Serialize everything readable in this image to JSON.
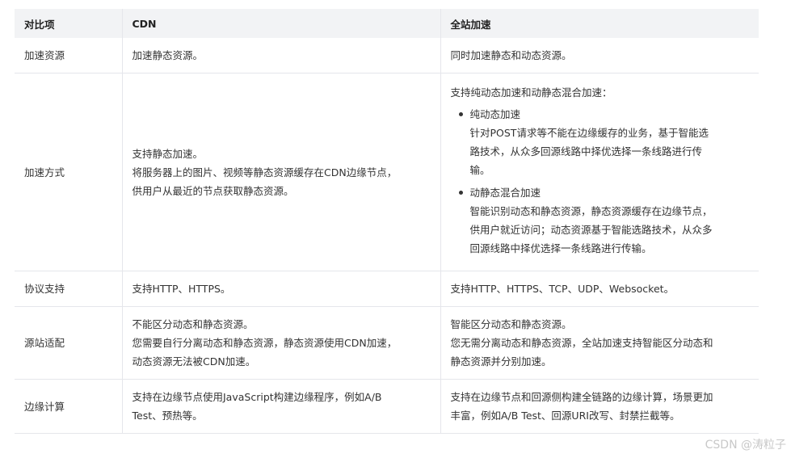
{
  "table": {
    "headers": {
      "item": "对比项",
      "cdn": "CDN",
      "full": "全站加速"
    },
    "rows": {
      "resources": {
        "item": "加速资源",
        "cdn": "加速静态资源。",
        "full": "同时加速静态和动态资源。"
      },
      "method": {
        "item": "加速方式",
        "cdn_lines": [
          "支持静态加速。",
          "将服务器上的图片、视频等静态资源缓存在CDN边缘节点，",
          "供用户从最近的节点获取静态资源。"
        ],
        "full_intro": "支持纯动态加速和动静态混合加速：",
        "full_bullets": [
          {
            "title": "纯动态加速",
            "lines": [
              "针对POST请求等不能在边缘缓存的业务，基于智能选",
              "路技术，从众多回源线路中择优选择一条线路进行传",
              "输。"
            ]
          },
          {
            "title": "动静态混合加速",
            "lines": [
              "智能识别动态和静态资源，静态资源缓存在边缘节点，",
              "供用户就近访问；动态资源基于智能选路技术，从众多",
              "回源线路中择优选择一条线路进行传输。"
            ]
          }
        ]
      },
      "protocol": {
        "item": "协议支持",
        "cdn": "支持HTTP、HTTPS。",
        "full": "支持HTTP、HTTPS、TCP、UDP、Websocket。"
      },
      "origin": {
        "item": "源站适配",
        "cdn_lines": [
          "不能区分动态和静态资源。",
          "您需要自行分离动态和静态资源，静态资源使用CDN加速，",
          "动态资源无法被CDN加速。"
        ],
        "full_lines": [
          "智能区分动态和静态资源。",
          "您无需分离动态和静态资源，全站加速支持智能区分动态和",
          "静态资源并分别加速。"
        ]
      },
      "edge": {
        "item": "边缘计算",
        "cdn_lines": [
          "支持在边缘节点使用JavaScript构建边缘程序，例如A/B",
          "Test、预热等。"
        ],
        "full_lines": [
          "支持在边缘节点和回源侧构建全链路的边缘计算，场景更加",
          "丰富，例如A/B Test、回源URI改写、封禁拦截等。"
        ]
      }
    }
  },
  "watermark": "CSDN @涛粒子"
}
